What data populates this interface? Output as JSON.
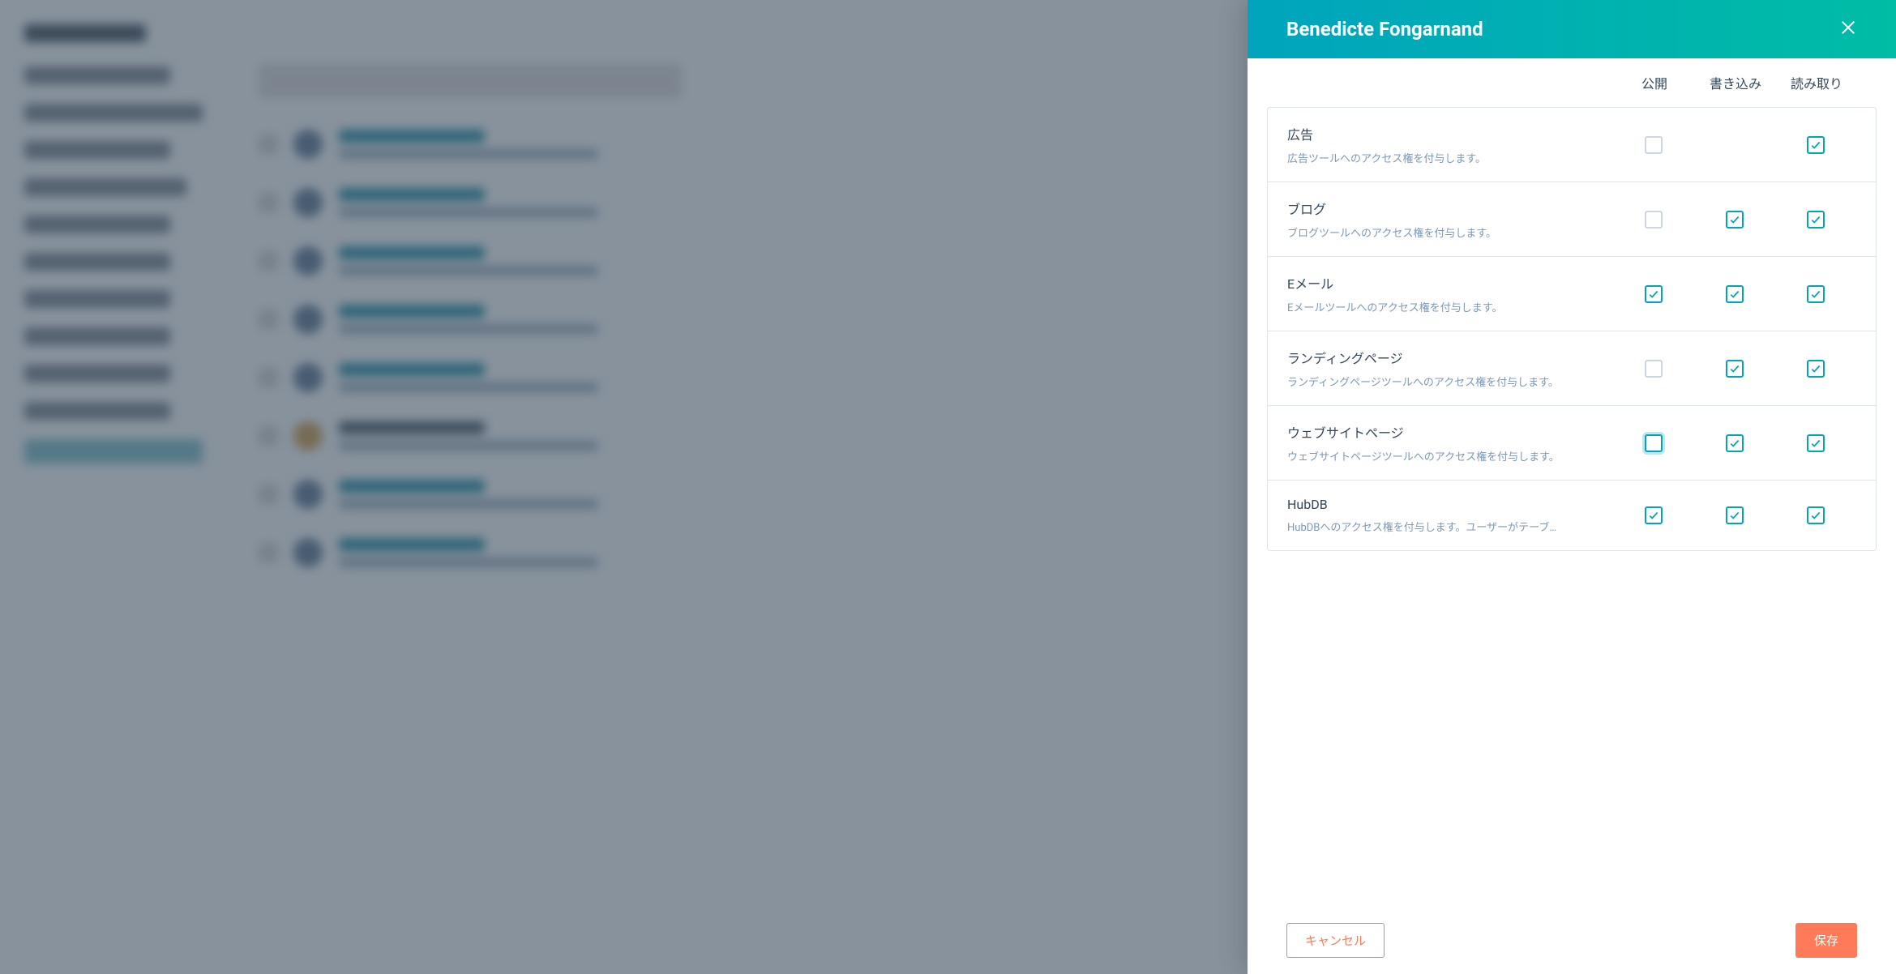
{
  "panel": {
    "title": "Benedicte Fongarnand",
    "columns": {
      "publish": "公開",
      "write": "書き込み",
      "read": "読み取り"
    },
    "permissions": [
      {
        "id": "ads",
        "title": "広告",
        "desc": "広告ツールへのアクセス権を付与します。",
        "publish": "unchecked",
        "write": null,
        "read": "checked"
      },
      {
        "id": "blog",
        "title": "ブログ",
        "desc": "ブログツールへのアクセス権を付与します。",
        "publish": "unchecked",
        "write": "checked",
        "read": "checked"
      },
      {
        "id": "email",
        "title": "Eメール",
        "desc": "Eメールツールへのアクセス権を付与します。",
        "publish": "checked",
        "write": "checked",
        "read": "checked"
      },
      {
        "id": "landing",
        "title": "ランディングページ",
        "desc": "ランディングページツールへのアクセス権を付与します。",
        "publish": "unchecked",
        "write": "checked",
        "read": "checked"
      },
      {
        "id": "website",
        "title": "ウェブサイトページ",
        "desc": "ウェブサイトページツールへのアクセス権を付与します。",
        "publish": "unchecked-focus",
        "write": "checked",
        "read": "checked"
      },
      {
        "id": "hubdb",
        "title": "HubDB",
        "desc": "HubDBへのアクセス権を付与します。ユーザーがテーブ…",
        "publish": "checked",
        "write": "checked",
        "read": "checked"
      }
    ],
    "footer": {
      "cancel": "キャンセル",
      "save": "保存"
    }
  }
}
